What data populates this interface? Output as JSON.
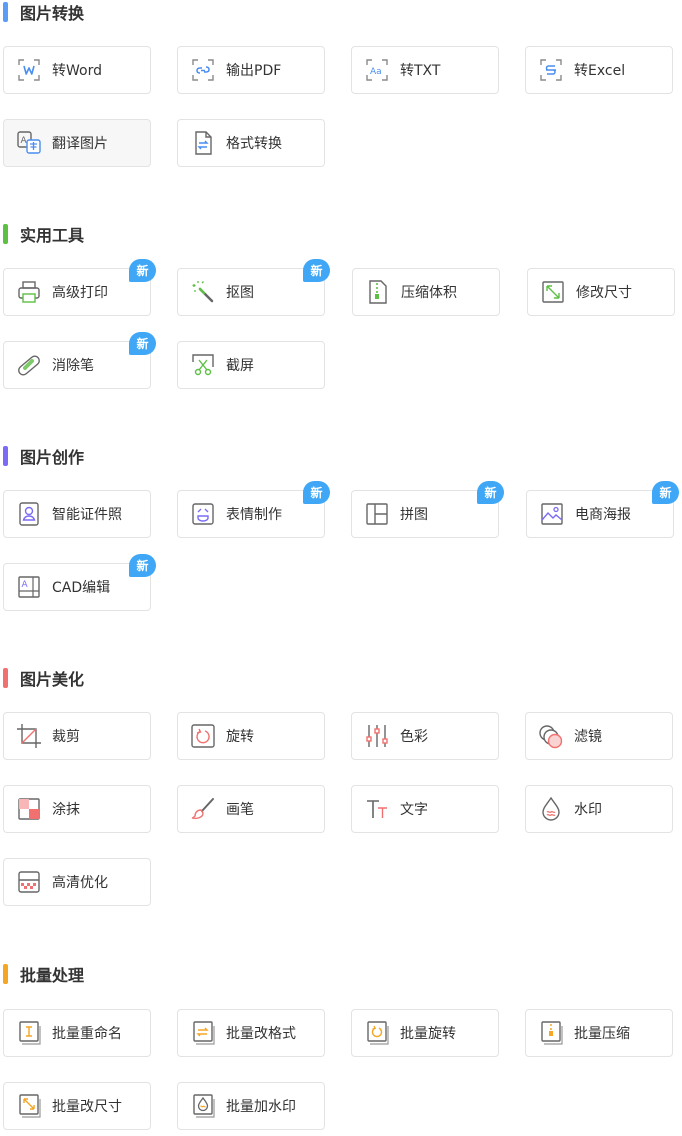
{
  "badge_text": "新",
  "sections": [
    {
      "title": "图片转换",
      "accent_color": "#5b9cf7",
      "items": [
        {
          "label": "转Word",
          "icon": "word-convert-icon"
        },
        {
          "label": "输出PDF",
          "icon": "pdf-export-icon"
        },
        {
          "label": "转TXT",
          "icon": "txt-convert-icon"
        },
        {
          "label": "转Excel",
          "icon": "excel-convert-icon"
        },
        {
          "label": "翻译图片",
          "icon": "translate-icon"
        },
        {
          "label": "格式转换",
          "icon": "format-convert-icon"
        }
      ]
    },
    {
      "title": "实用工具",
      "accent_color": "#5dbf43",
      "items": [
        {
          "label": "高级打印",
          "icon": "printer-icon",
          "new": true
        },
        {
          "label": "抠图",
          "icon": "magic-wand-icon",
          "new": true
        },
        {
          "label": "压缩体积",
          "icon": "zip-file-icon"
        },
        {
          "label": "修改尺寸",
          "icon": "resize-icon"
        },
        {
          "label": "消除笔",
          "icon": "eraser-pill-icon",
          "new": true
        },
        {
          "label": "截屏",
          "icon": "scissors-icon"
        }
      ]
    },
    {
      "title": "图片创作",
      "accent_color": "#7b6cf6",
      "items": [
        {
          "label": "智能证件照",
          "icon": "id-photo-icon"
        },
        {
          "label": "表情制作",
          "icon": "emoji-icon",
          "new": true
        },
        {
          "label": "拼图",
          "icon": "collage-icon",
          "new": true
        },
        {
          "label": "电商海报",
          "icon": "poster-icon",
          "new": true
        },
        {
          "label": "CAD编辑",
          "icon": "cad-icon",
          "new": true
        }
      ]
    },
    {
      "title": "图片美化",
      "accent_color": "#f0716f",
      "items": [
        {
          "label": "裁剪",
          "icon": "crop-icon"
        },
        {
          "label": "旋转",
          "icon": "rotate-icon"
        },
        {
          "label": "色彩",
          "icon": "color-sliders-icon"
        },
        {
          "label": "滤镜",
          "icon": "filter-icon"
        },
        {
          "label": "涂抹",
          "icon": "smudge-icon"
        },
        {
          "label": "画笔",
          "icon": "brush-icon"
        },
        {
          "label": "文字",
          "icon": "text-icon"
        },
        {
          "label": "水印",
          "icon": "watermark-icon"
        },
        {
          "label": "高清优化",
          "icon": "hd-enhance-icon"
        }
      ]
    },
    {
      "title": "批量处理",
      "accent_color": "#f5a623",
      "items": [
        {
          "label": "批量重命名",
          "icon": "batch-rename-icon"
        },
        {
          "label": "批量改格式",
          "icon": "batch-format-icon"
        },
        {
          "label": "批量旋转",
          "icon": "batch-rotate-icon"
        },
        {
          "label": "批量压缩",
          "icon": "batch-compress-icon"
        },
        {
          "label": "批量改尺寸",
          "icon": "batch-resize-icon"
        },
        {
          "label": "批量加水印",
          "icon": "batch-watermark-icon"
        }
      ]
    }
  ]
}
